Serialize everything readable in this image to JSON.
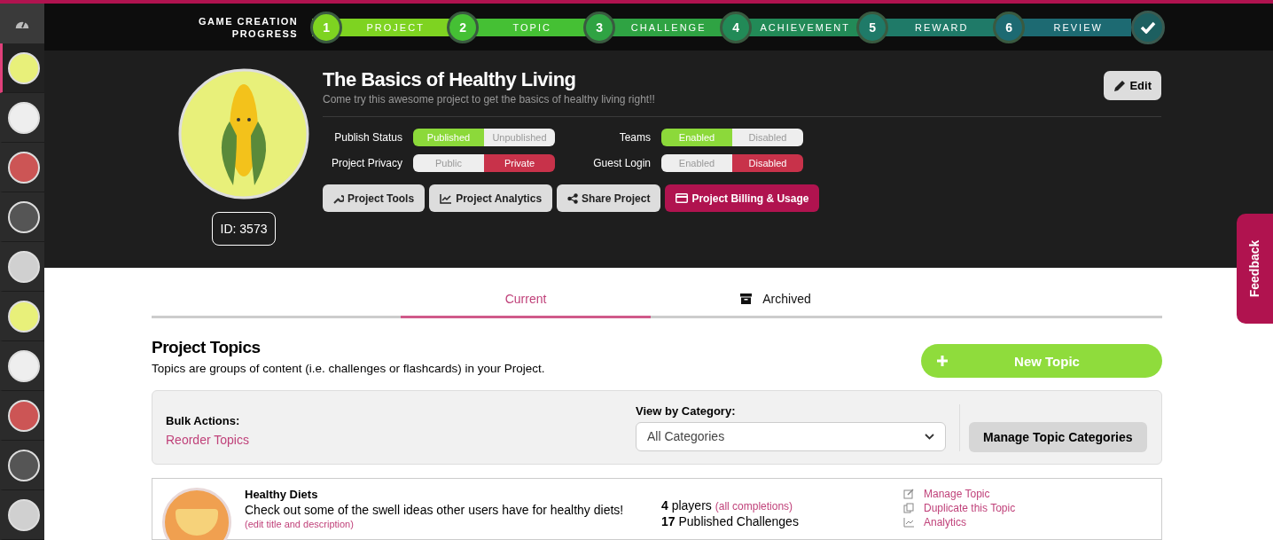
{
  "sidebar": {
    "projects": [
      {
        "selected": true
      },
      {
        "selected": false
      },
      {
        "selected": false
      },
      {
        "selected": false
      },
      {
        "selected": false
      },
      {
        "selected": false
      },
      {
        "selected": false
      },
      {
        "selected": false
      },
      {
        "selected": false
      },
      {
        "selected": false
      }
    ]
  },
  "progress": {
    "label_line1": "GAME CREATION",
    "label_line2": "PROGRESS",
    "steps": [
      {
        "number": "1",
        "label": "PROJECT",
        "color": "#7ed321"
      },
      {
        "number": "2",
        "label": "TOPIC",
        "color": "#45c034"
      },
      {
        "number": "3",
        "label": "CHALLENGE",
        "color": "#2fa343"
      },
      {
        "number": "4",
        "label": "ACHIEVEMENT",
        "color": "#228a57"
      },
      {
        "number": "5",
        "label": "REWARD",
        "color": "#1f7a68"
      },
      {
        "number": "6",
        "label": "REVIEW",
        "color": "#1d6a72"
      }
    ]
  },
  "project": {
    "title": "The Basics of Healthy Living",
    "description": "Come try this awesome project to get the basics of healthy living right!!",
    "id": "ID: 3573",
    "edit_button": "Edit",
    "toggles": [
      {
        "label": "Publish Status",
        "color": "#8cd93a",
        "options": [
          {
            "label": "Published",
            "selected": true
          },
          {
            "label": "Unpublished",
            "selected": false
          }
        ]
      },
      {
        "label": "Teams",
        "color": "#8cd93a",
        "options": [
          {
            "label": "Enabled",
            "selected": true
          },
          {
            "label": "Disabled",
            "selected": false
          }
        ]
      },
      {
        "label": "Project Privacy",
        "color": "#c8324a",
        "options": [
          {
            "label": "Public",
            "selected": false
          },
          {
            "label": "Private",
            "selected": true
          }
        ]
      },
      {
        "label": "Guest Login",
        "color": "#c8324a",
        "options": [
          {
            "label": "Enabled",
            "selected": false
          },
          {
            "label": "Disabled",
            "selected": true
          }
        ]
      }
    ],
    "actions": [
      {
        "label": "Project Tools",
        "kind": "tools"
      },
      {
        "label": "Project Analytics",
        "kind": "analytics"
      },
      {
        "label": "Share Project",
        "kind": "share"
      },
      {
        "label": "Project Billing & Usage",
        "kind": "billing"
      }
    ]
  },
  "tabs": [
    {
      "label": "Current",
      "selected": true
    },
    {
      "label": "Archived",
      "selected": false
    }
  ],
  "topics": {
    "title": "Project Topics",
    "subtitle": "Topics are groups of content (i.e. challenges or flashcards) in your Project.",
    "new_button": "New Topic",
    "bulk_label": "Bulk Actions:",
    "bulk_link": "Reorder Topics",
    "category_label": "View by Category:",
    "category_value": "All Categories",
    "manage_button": "Manage Topic Categories",
    "rows": [
      {
        "name": "Healthy Diets",
        "description": "Check out some of the swell ideas other users have for healthy diets!",
        "edit_link": "(edit title and description)",
        "players_count": "4",
        "players_text": "players",
        "completions_link": "(all completions)",
        "challenges_count": "17",
        "challenges_text": "Published Challenges",
        "links": [
          {
            "label": "Manage Topic",
            "kind": "manage"
          },
          {
            "label": "Duplicate this Topic",
            "kind": "duplicate"
          },
          {
            "label": "Analytics",
            "kind": "analytics"
          }
        ]
      }
    ]
  },
  "feedback": "Feedback"
}
